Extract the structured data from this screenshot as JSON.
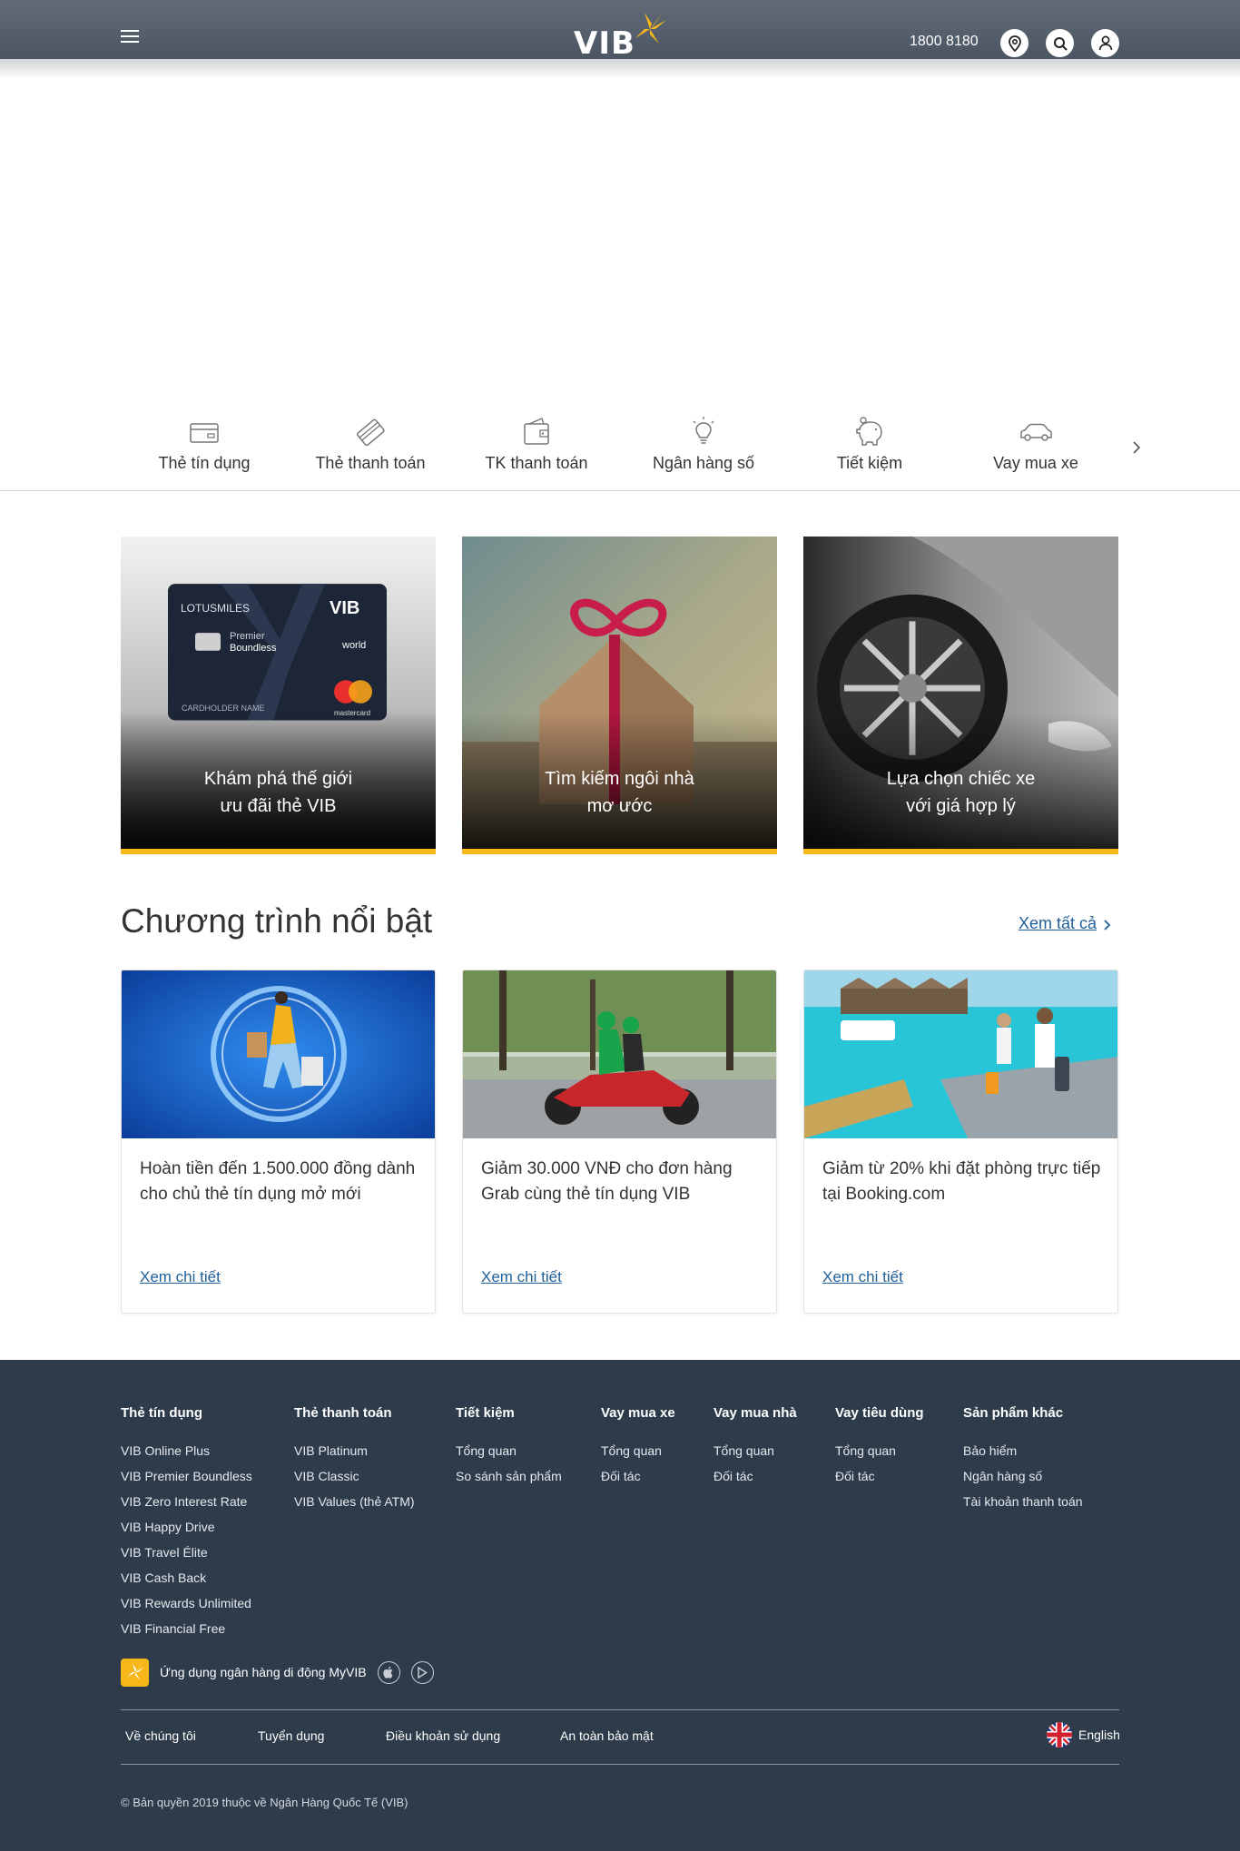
{
  "header": {
    "brand": "VIB",
    "hotline": "1800 8180",
    "icons": [
      "menu-icon",
      "location-icon",
      "search-icon",
      "user-icon"
    ]
  },
  "quicknav": {
    "items": [
      {
        "label": "Thẻ tín dụng",
        "icon": "credit-card-icon"
      },
      {
        "label": "Thẻ thanh toán",
        "icon": "payment-card-icon"
      },
      {
        "label": "TK thanh toán",
        "icon": "wallet-icon"
      },
      {
        "label": "Ngân hàng số",
        "icon": "lightbulb-icon"
      },
      {
        "label": "Tiết kiệm",
        "icon": "piggy-bank-icon"
      },
      {
        "label": "Vay mua xe",
        "icon": "car-icon"
      }
    ]
  },
  "features": [
    {
      "caption_line1": "Khám phá thế giới",
      "caption_line2": "ưu đãi thẻ VIB",
      "card_brand": "VIB",
      "card_airline": "LOTUSMILES",
      "card_tier": "Premier",
      "card_name": "Boundless",
      "card_world": "world",
      "card_holder": "CARDHOLDER NAME",
      "card_network": "mastercard"
    },
    {
      "caption_line1": "Tìm kiếm ngôi nhà",
      "caption_line2": "mơ ước"
    },
    {
      "caption_line1": "Lựa chọn chiếc xe",
      "caption_line2": "với giá hợp lý"
    }
  ],
  "programs": {
    "title": "Chương trình nổi bật",
    "see_all": "Xem tất cả",
    "items": [
      {
        "text": "Hoàn tiền đến 1.500.000 đồng dành cho chủ thẻ tín dụng mở mới",
        "link": "Xem chi tiết"
      },
      {
        "text": "Giảm 30.000 VNĐ cho đơn hàng Grab cùng thẻ tín dụng VIB",
        "link": "Xem chi tiết"
      },
      {
        "text": "Giảm từ 20% khi đặt phòng trực tiếp tại Booking.com",
        "link": "Xem chi tiết"
      }
    ]
  },
  "footer": {
    "columns": [
      {
        "title": "Thẻ tín dụng",
        "links": [
          "VIB Online Plus",
          "VIB Premier Boundless",
          "VIB Zero Interest Rate",
          "VIB Happy Drive",
          "VIB Travel Élite",
          "VIB Cash Back",
          "VIB Rewards Unlimited",
          "VIB Financial Free"
        ]
      },
      {
        "title": "Thẻ thanh toán",
        "links": [
          "VIB Platinum",
          "VIB Classic",
          "VIB Values (thẻ ATM)"
        ]
      },
      {
        "title": "Tiết kiệm",
        "links": [
          "Tổng quan",
          "So sánh sản phẩm"
        ]
      },
      {
        "title": "Vay mua xe",
        "links": [
          "Tổng quan",
          "Đối tác"
        ]
      },
      {
        "title": "Vay mua nhà",
        "links": [
          "Tổng quan",
          "Đối tác"
        ]
      },
      {
        "title": "Vay tiêu dùng",
        "links": [
          "Tổng quan",
          "Đối tác"
        ]
      },
      {
        "title": "Sản phẩm khác",
        "links": [
          "Bảo hiểm",
          "Ngân hàng số",
          "Tài khoản thanh toán"
        ]
      }
    ],
    "app_text": "Ứng dụng ngân hàng di động MyVIB",
    "bottom_links": [
      "Về chúng tôi",
      "Tuyển dụng",
      "Điều khoản sử dụng",
      "An toàn bảo mật"
    ],
    "language": "English",
    "copyright": "© Bản quyền 2019 thuộc về Ngân Hàng Quốc Tế (VIB)"
  },
  "colors": {
    "header": "#566170",
    "accent": "#f7b718",
    "link": "#1f5f9c",
    "footer": "#2e3b4b"
  }
}
